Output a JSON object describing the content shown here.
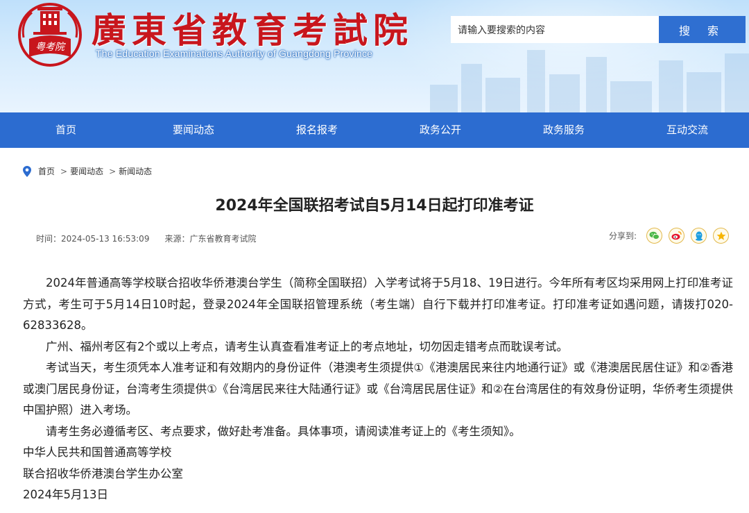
{
  "header": {
    "site_title": "廣東省教育考試院",
    "site_subtitle": "The Education Examinations Authority of Guangdong Province",
    "logo_text": "粤考院",
    "search_placeholder": "请输入要搜索的内容",
    "search_button": "搜 索"
  },
  "nav": {
    "items": [
      "首页",
      "要闻动态",
      "报名报考",
      "政务公开",
      "政务服务",
      "互动交流"
    ]
  },
  "breadcrumb": {
    "items": [
      "首页",
      "要闻动态",
      "新闻动态"
    ],
    "separator": ">"
  },
  "article": {
    "title": "2024年全国联招考试自5月14日起打印准考证",
    "time": "时间：2024-05-13 16:53:09",
    "source": "来源：广东省教育考试院",
    "share_label": "分享到:",
    "paragraphs": [
      "2024年普通高等学校联合招收华侨港澳台学生（简称全国联招）入学考试将于5月18、19日进行。今年所有考区均采用网上打印准考证方式，考生可于5月14日10时起，登录2024年全国联招管理系统（考生端）自行下载并打印准考证。打印准考证如遇问题，请拨打020-62833628。",
      "广州、福州考区有2个或以上考点，请考生认真查看准考证上的考点地址，切勿因走错考点而耽误考试。",
      "考试当天，考生须凭本人准考证和有效期内的身份证件（港澳考生须提供①《港澳居民来往内地通行证》或《港澳居民居住证》和②香港或澳门居民身份证，台湾考生须提供①《台湾居民来往大陆通行证》或《台湾居民居住证》和②在台湾居住的有效身份证明，华侨考生须提供中国护照）进入考场。",
      "请考生务必遵循考区、考点要求，做好赴考准备。具体事项，请阅读准考证上的《考生须知》。"
    ],
    "signature": [
      "中华人民共和国普通高等学校",
      "联合招收华侨港澳台学生办公室",
      "2024年5月13日"
    ]
  },
  "colors": {
    "brand_red": "#c8161d",
    "nav_blue": "#2c6cd0",
    "search_button_blue": "#2f6fd1",
    "header_bg": "#cfe7fc"
  },
  "icons": {
    "share": [
      "wechat-icon",
      "weibo-icon",
      "qq-icon",
      "qzone-icon"
    ],
    "breadcrumb": "location-pin-icon"
  }
}
